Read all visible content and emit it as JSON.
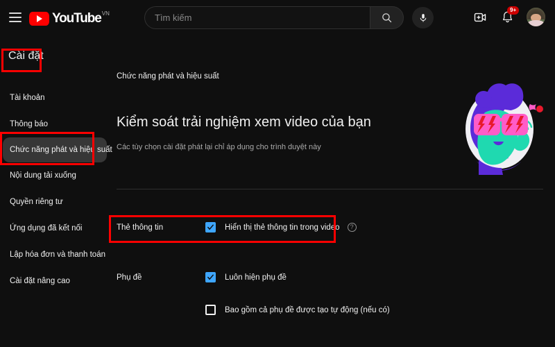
{
  "header": {
    "menu_icon": "hamburger-menu-icon",
    "logo_text": "YouTube",
    "logo_country": "VN",
    "search_placeholder": "Tìm kiếm",
    "search_value": "",
    "search_icon": "search-icon",
    "mic_icon": "microphone-icon",
    "create_icon": "create-video-icon",
    "notifications_icon": "bell-icon",
    "notifications_badge": "9+",
    "avatar_icon": "user-avatar"
  },
  "sidebar": {
    "title": "Cài đặt",
    "items": [
      {
        "label": "Tài khoản",
        "active": false
      },
      {
        "label": "Thông báo",
        "active": false
      },
      {
        "label": "Chức năng phát và hiệu suất",
        "active": true
      },
      {
        "label": "Nội dung tải xuống",
        "active": false
      },
      {
        "label": "Quyền riêng tư",
        "active": false
      },
      {
        "label": "Ứng dụng đã kết nối",
        "active": false
      },
      {
        "label": "Lập hóa đơn và thanh toán",
        "active": false
      },
      {
        "label": "Cài đặt nâng cao",
        "active": false
      }
    ]
  },
  "main": {
    "breadcrumb": "Chức năng phát và hiệu suất",
    "title": "Kiểm soát trải nghiệm xem video của bạn",
    "subtitle": "Các tùy chọn cài đặt phát lại chỉ áp dụng cho trình duyệt này",
    "illustration": "person-with-sunglasses-illustration"
  },
  "settings": {
    "cards": {
      "label": "Thẻ thông tin",
      "option_label": "Hiển thị thẻ thông tin trong video",
      "checked": true,
      "help_icon": "help-circle-icon"
    },
    "subtitles": {
      "label": "Phụ đề",
      "option1_label": "Luôn hiện phụ đề",
      "option1_checked": true,
      "option2_label": "Bao gồm cả phụ đề được tạo tự động (nếu có)",
      "option2_checked": false
    }
  },
  "annotations": {
    "color": "#ff0000",
    "boxes": [
      "settings-title",
      "active-nav-item",
      "info-cards-row"
    ]
  },
  "colors": {
    "background": "#0f0f0f",
    "text_primary": "#f1f1f1",
    "text_secondary": "#aaaaaa",
    "accent_blue": "#3ea6ff",
    "brand_red": "#ff0000",
    "active_pill": "#373737",
    "illus_purple": "#5b2bd9",
    "illus_teal": "#1fd9b0",
    "illus_pink": "#ff5cc8",
    "illus_red": "#e8192c",
    "illus_white": "#f0eff4"
  }
}
